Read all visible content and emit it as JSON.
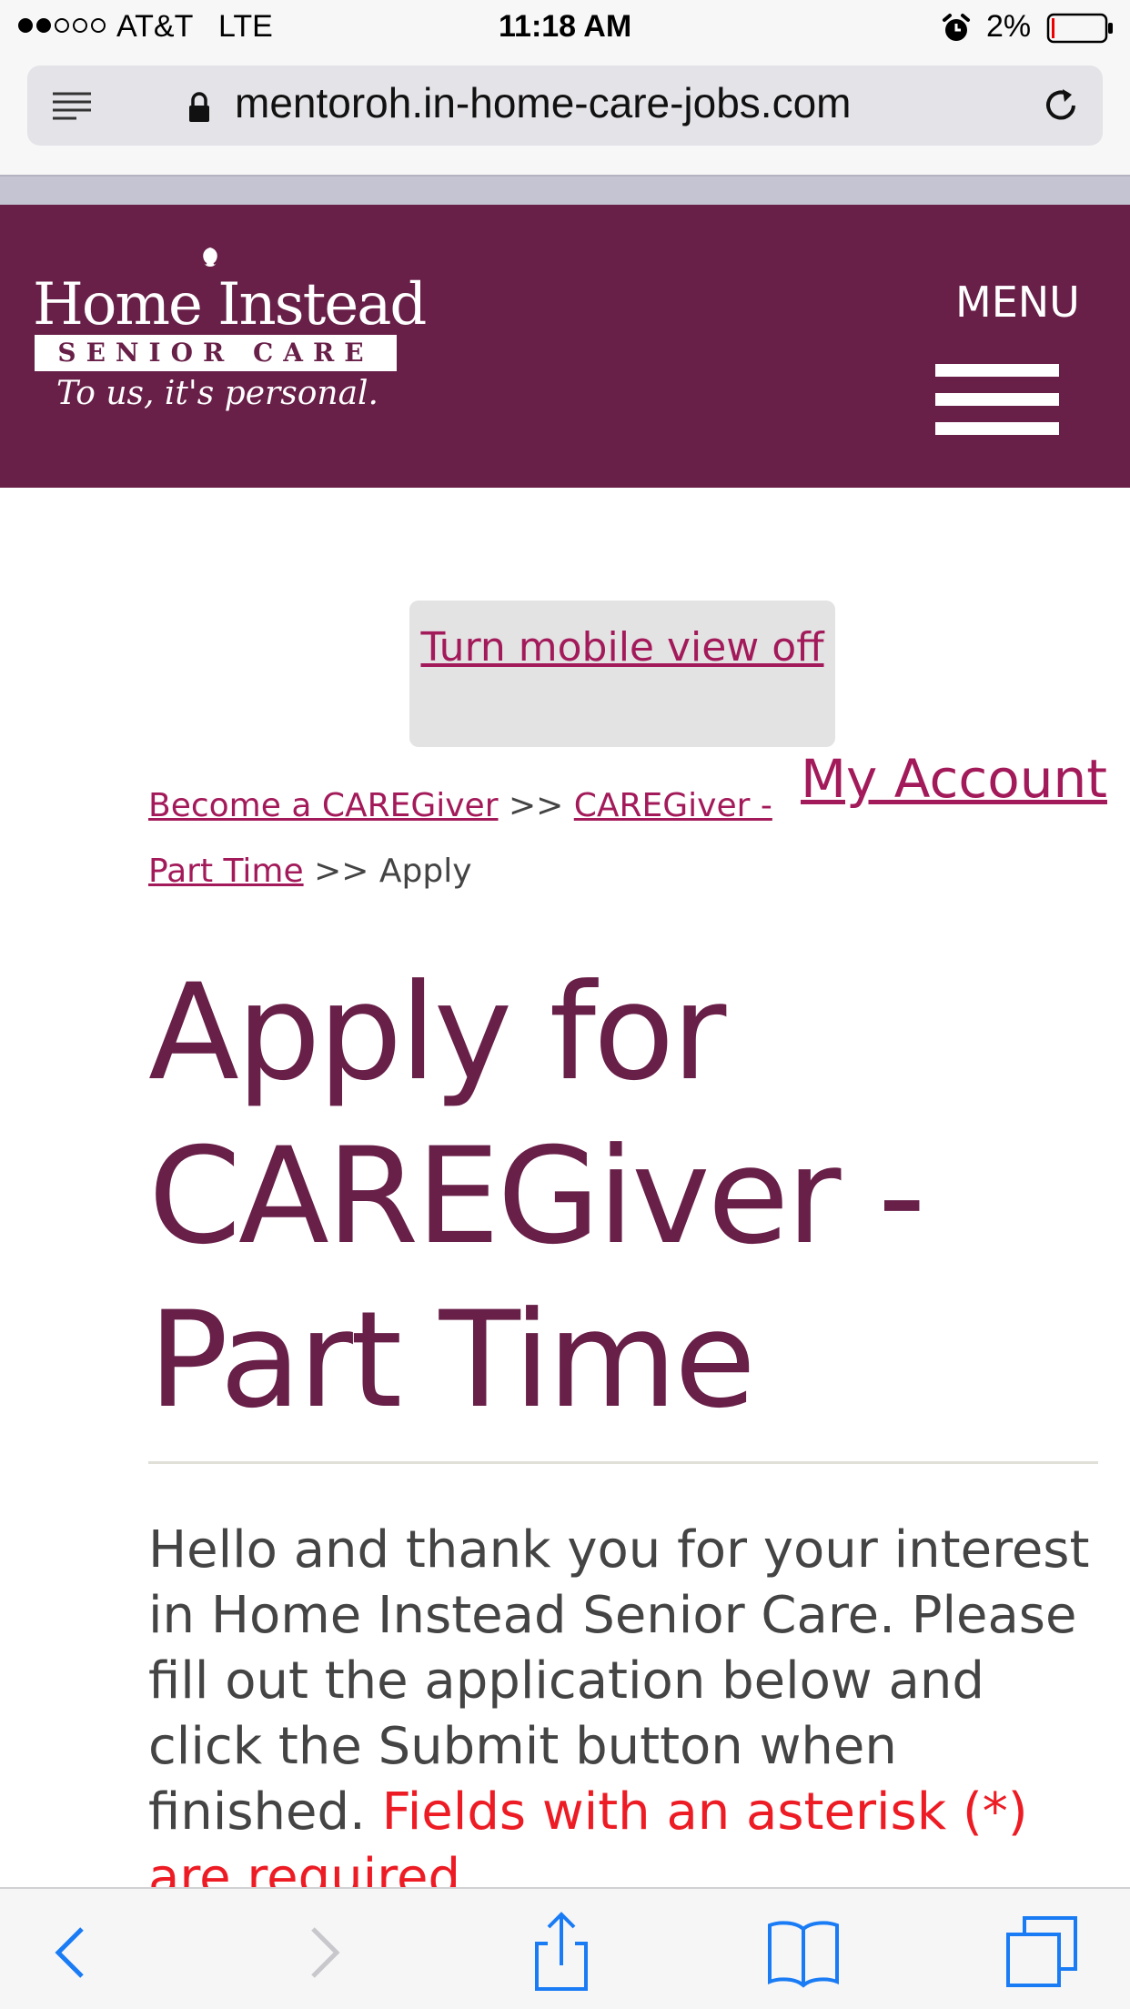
{
  "status_bar": {
    "carrier": "AT&T",
    "network": "LTE",
    "time": "11:18 AM",
    "battery": "2%",
    "signal_bars_filled": 2,
    "signal_bars_total": 5
  },
  "browser": {
    "url": "mentoroh.in-home-care-jobs.com"
  },
  "header": {
    "logo_main": "Home Instead",
    "logo_sub": "SENIOR CARE",
    "logo_tagline": "To us, it's personal.",
    "menu_label": "MENU"
  },
  "content": {
    "mobile_toggle": "Turn mobile view off",
    "my_account": "My Account",
    "breadcrumb": {
      "item1": "Become a CAREGiver",
      "item2": "CAREGiver - Part Time",
      "current": "Apply",
      "separator": ">>"
    },
    "title": "Apply for CAREGiver - Part Time",
    "intro_text": "Hello and thank you for your interest in Home Instead Senior Care. Please fill out the application below and click the Submit button when finished.",
    "required_note": "Fields with an asterisk (*) are required."
  },
  "colors": {
    "brand": "#681f48",
    "link": "#a31a5a",
    "required": "#ed1c24",
    "ios_blue": "#1a7cf5"
  }
}
